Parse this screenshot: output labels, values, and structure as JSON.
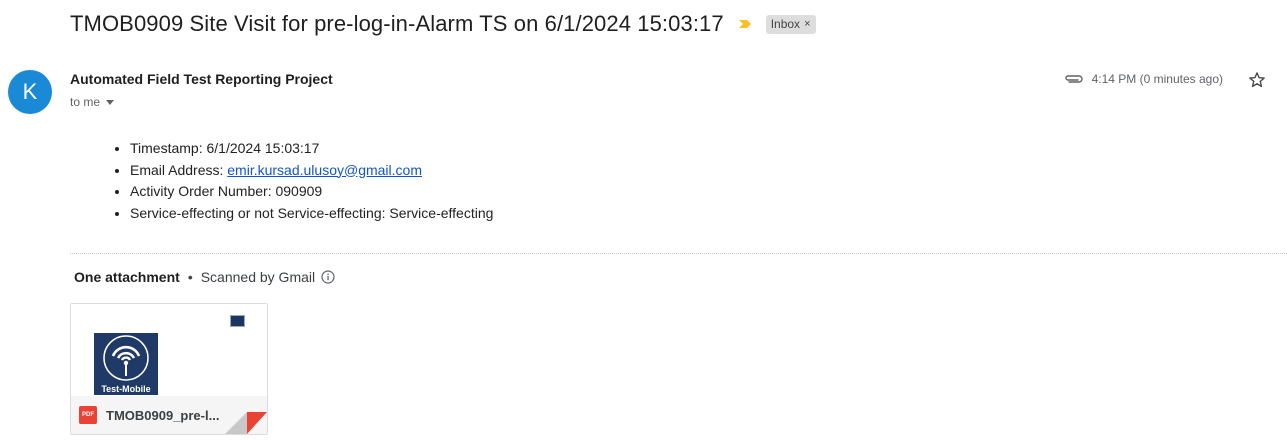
{
  "subject": "TMOB0909 Site Visit for pre-log-in-Alarm TS on 6/1/2024 15:03:17",
  "label_chip": {
    "text": "Inbox",
    "close": "×"
  },
  "sender": {
    "initial": "K",
    "name": "Automated Field Test Reporting Project",
    "recipient": "to me"
  },
  "meta": {
    "time": "4:14 PM (0 minutes ago)"
  },
  "body": {
    "items": [
      "Timestamp: 6/1/2024 15:03:17",
      "Email Address: ",
      "Activity Order Number: 090909",
      "Service-effecting or not Service-effecting: Service-effecting"
    ],
    "email_link": "emir.kursad.ulusoy@gmail.com"
  },
  "attachments": {
    "count_label": "One attachment",
    "separator": "•",
    "scanned_label": "Scanned by Gmail",
    "file": {
      "name": "TMOB0909_pre-l...",
      "type_label": "PDF",
      "logo_text": "Test-Mobile"
    }
  },
  "colors": {
    "avatar": "#1a8ad6",
    "important": "#f6c026",
    "link": "#1155cc",
    "pdf": "#ea4335"
  },
  "icons": [
    "important-marker-icon",
    "paperclip-icon",
    "star-icon",
    "info-icon",
    "pdf-icon"
  ]
}
